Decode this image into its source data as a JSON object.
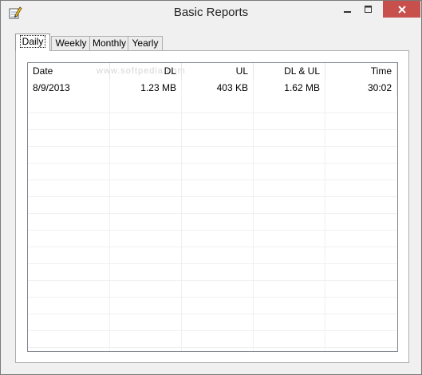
{
  "window": {
    "title": "Basic Reports",
    "icon": "pencil-notepad-icon",
    "controls": [
      "minimize-icon",
      "maximize-icon",
      "close-icon"
    ],
    "close_color": "#c7504d"
  },
  "tabs": [
    {
      "label": "Daily",
      "active": true
    },
    {
      "label": "Weekly",
      "active": false
    },
    {
      "label": "Monthly",
      "active": false
    },
    {
      "label": "Yearly",
      "active": false
    }
  ],
  "table": {
    "columns": [
      "Date",
      "DL",
      "UL",
      "DL & UL",
      "Time"
    ],
    "rows": [
      [
        "8/9/2013",
        "1.23 MB",
        "403 KB",
        "1.62 MB",
        "30:02"
      ]
    ]
  },
  "watermark": "www.softpedia.com"
}
